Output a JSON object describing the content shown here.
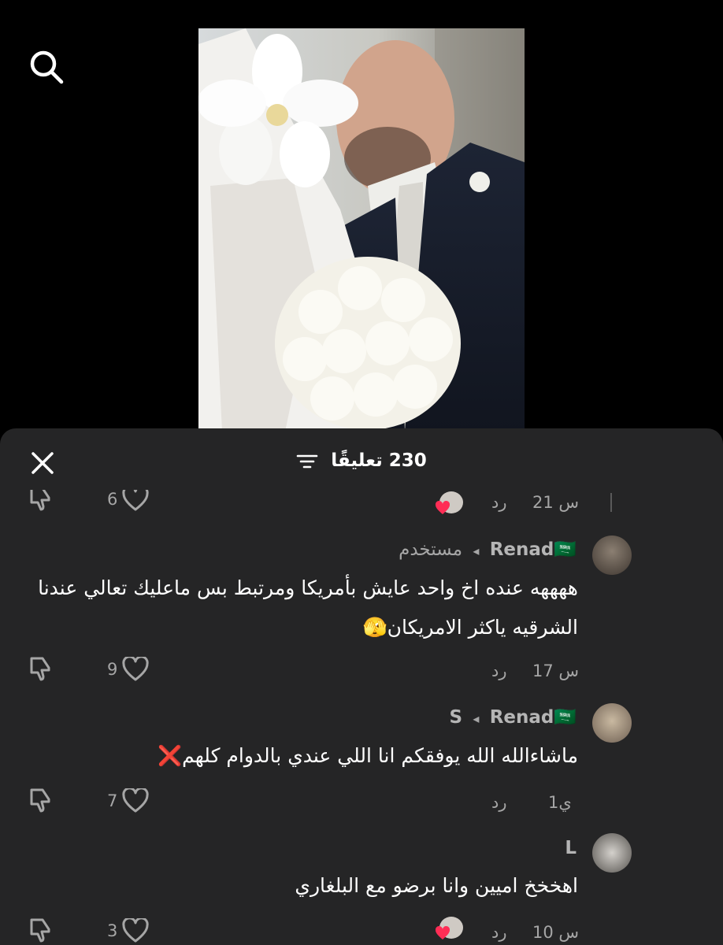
{
  "comments_sheet": {
    "count_label": "230 تعليقًا",
    "close_icon": "close-icon",
    "filter_icon": "filter-icon"
  },
  "partial_comment": {
    "time": "21 س",
    "reply_label": "رد",
    "likes": "6"
  },
  "comments": [
    {
      "author": "Renad🇸🇦",
      "reply_indicator": "◂",
      "reply_to": "مستخدم",
      "text": "ههههه عنده اخ واحد عايش بأمريكا ومرتبط بس ماعليك تعالي عندنا الشرقيه ياكثر الامريكان🫣",
      "time": "17 س",
      "reply_label": "رد",
      "likes": "9"
    },
    {
      "author": "S",
      "reply_indicator": "◂",
      "reply_to": "Renad🇸🇦",
      "text": "ماشاءالله الله يوفقكم انا اللي عندي بالدوام كلهم❌",
      "time": "1ي",
      "reply_label": "رد",
      "likes": "7"
    },
    {
      "author": "L",
      "text": "اهخخخ اميين وانا برضو مع البلغاري",
      "time": "10 س",
      "reply_label": "رد",
      "likes": "3"
    }
  ],
  "colors": {
    "sheet_bg": "#252526",
    "muted_text": "#a6a6a6",
    "heart_red": "#ff2d55"
  }
}
